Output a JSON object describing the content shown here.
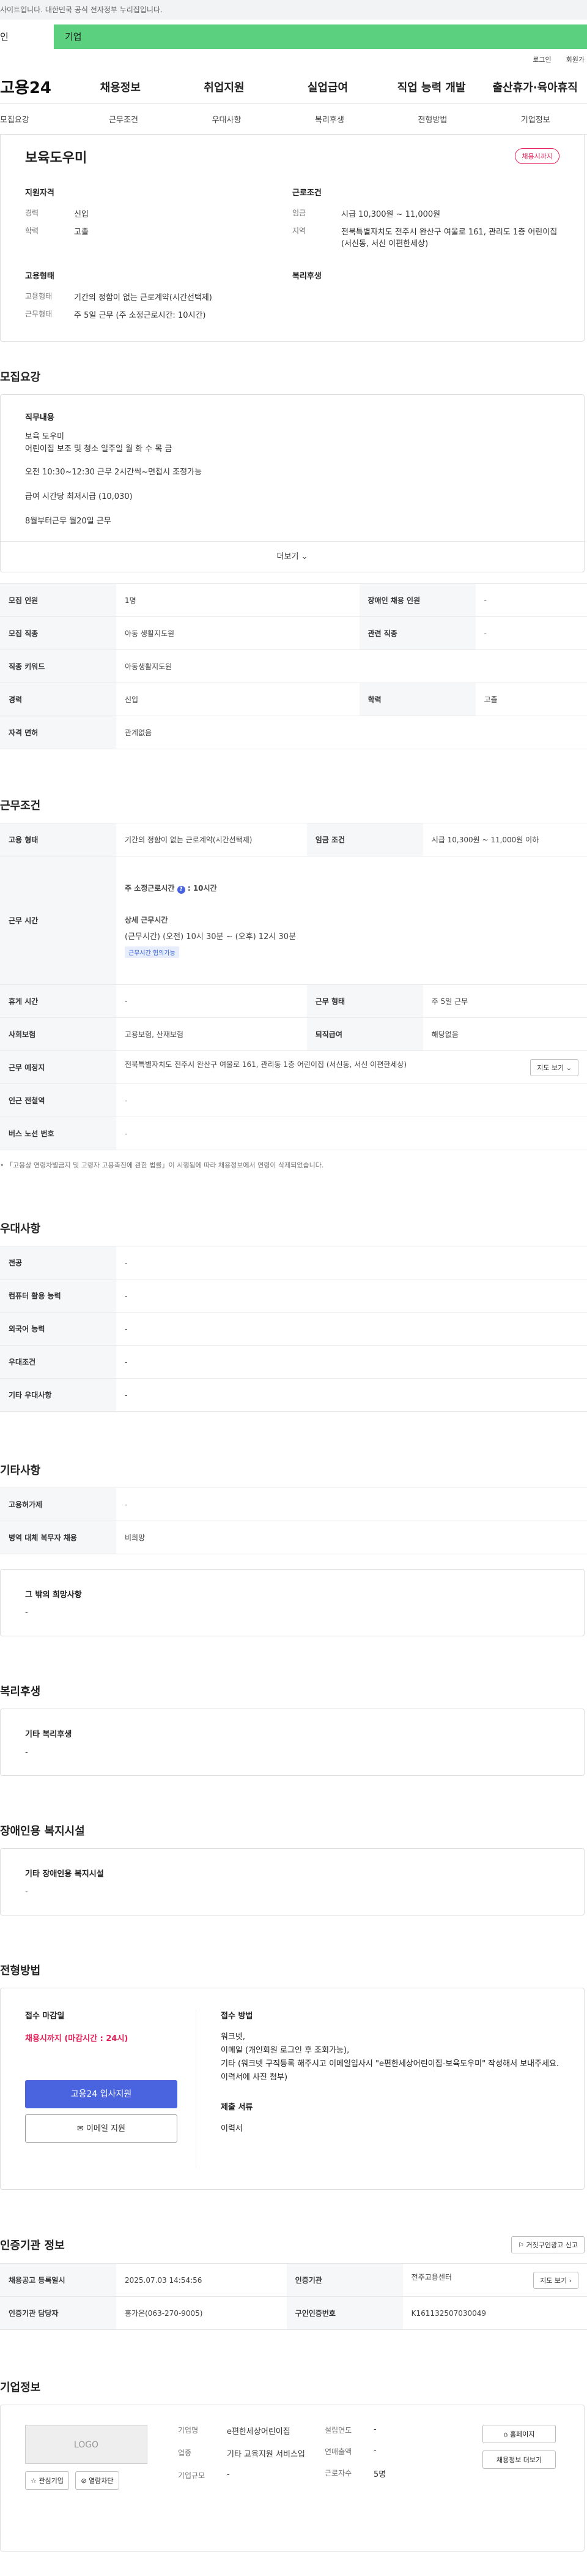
{
  "notice": "사이트입니다. 대한민국 공식 전자정부 누리집입니다.",
  "tabs": {
    "individual": "인",
    "enterprise": "기업"
  },
  "util": {
    "login": "로그인",
    "join": "회원가"
  },
  "logo": "고용24",
  "gnb": [
    "채용정보",
    "취업지원",
    "실업급여",
    "직업 능력 개발",
    "출산휴가·육아휴직"
  ],
  "subnav": [
    "모집요강",
    "근무조건",
    "우대사항",
    "복리후생",
    "전형방법",
    "기업정보"
  ],
  "summary": {
    "title": "보육도우미",
    "badge": "채용시까지",
    "qualification_title": "지원자격",
    "career_label": "경력",
    "career_value": "신입",
    "edu_label": "학력",
    "edu_value": "고졸",
    "emp_title": "고용형태",
    "emptype_label": "고용형태",
    "emptype_value": "기간의 정함이 없는 근로계약(시간선택제)",
    "workform_label": "근무형태",
    "workform_value": "주 5일 근무 (주 소정근로시간: 10시간)",
    "cond_title": "근로조건",
    "wage_label": "임금",
    "wage_value": "시급 10,300원 ~ 11,000원",
    "region_label": "지역",
    "region_value": "전북특별자치도 전주시 완산구 여울로 161, 관리도 1층 어린이집 (서신동, 서신 이편한세상)",
    "welfare_title": "복리후생"
  },
  "recruit": {
    "heading": "모집요강",
    "duty_title": "직무내용",
    "lines": [
      "보육 도우미",
      "어린이집 보조 및 청소 일주일 월 화 수 목 금",
      "오전 10:30~12:30 근무  2시간씩~면접시 조정가능",
      "급여 시간당 최저시급 (10,030)",
      "8월부터근무 월20일 근무"
    ],
    "more": "더보기"
  },
  "recruit_table": [
    [
      "모집 인원",
      "1명",
      "장애인 채용 인원",
      "-"
    ],
    [
      "모집 직종",
      "아동 생활지도원",
      "관련 직종",
      "-"
    ],
    [
      "직종 키워드",
      "아동생활지도원",
      "",
      ""
    ],
    [
      "경력",
      "신입",
      "학력",
      "고졸"
    ],
    [
      "자격 면허",
      "관계없음",
      "",
      ""
    ]
  ],
  "work": {
    "heading": "근무조건",
    "emp_type_h": "고용 형태",
    "emp_type_v": "기간의 정함이 없는 근로계약(시간선택제)",
    "wage_h": "임금 조건",
    "wage_v": "시급 10,300원 ~ 11,000원 이하",
    "time_h": "근무 시간",
    "weekly": "주 소정근로시간",
    "weekly_v": "10시간",
    "detail": "상세 근무시간",
    "detail_v": "(근무시간) (오전) 10시 30분 ~ (오후) 12시 30분",
    "chip": "근무시간 협의가능",
    "rest_h": "휴게 시간",
    "rest_v": "-",
    "form_h": "근무 형태",
    "form_v": "주 5일 근무",
    "ins_h": "사회보험",
    "ins_v": "고용보험, 산재보험",
    "ret_h": "퇴직급여",
    "ret_v": "해당없음",
    "place_h": "근무 예정지",
    "place_v": "전북특별자치도 전주시 완산구 여울로 161, 관리동 1층 어린이집 (서신동, 서신 이편한세상)",
    "map_btn": "지도 보기",
    "subway_h": "인근 전철역",
    "subway_v": "-",
    "bus_h": "버스 노선 번호",
    "bus_v": "-",
    "note": "「고용상 연령차별금지 및 고령자 고용촉진에 관한 법률」이 시행됨에 따라 채용정보에서 연령이 삭제되었습니다."
  },
  "pref": {
    "heading": "우대사항",
    "rows": [
      [
        "전공",
        "-"
      ],
      [
        "컴퓨터 활용 능력",
        "-"
      ],
      [
        "외국어 능력",
        "-"
      ],
      [
        "우대조건",
        "-"
      ],
      [
        "기타 우대사항",
        "-"
      ]
    ]
  },
  "etc": {
    "heading": "기타사항",
    "rows": [
      [
        "고용허가제",
        "-"
      ],
      [
        "병역 대체 복무자 채용",
        "비희망"
      ]
    ],
    "box_title": "그 밖의 희망사항",
    "box_value": "-"
  },
  "welfare": {
    "heading": "복리후생",
    "box_title": "기타 복리후생",
    "box_value": "-"
  },
  "disabled": {
    "heading": "장애인용 복지시설",
    "box_title": "기타 장애인용 복지시설",
    "box_value": "-"
  },
  "selection": {
    "heading": "전형방법",
    "deadline_title": "접수 마감일",
    "deadline_value": "채용시까지 (마감시간 : 24시)",
    "apply_btn": "고용24 입사지원",
    "email_btn": "이메일 지원",
    "method_title": "접수 방법",
    "method_lines": [
      "워크넷,",
      "이메일 (개인회원 로그인 후 조회가능),",
      "기타 (워크넷 구직등록 해주시고 이메일입사시 \"e편한세상어린이집-보육도우미\" 작성해서 보내주세요. 이력서에 사진 첨부)"
    ],
    "docs_title": "제출 서류",
    "docs_value": "이력서"
  },
  "cert": {
    "heading": "인증기관 정보",
    "report_btn": "거짓구인광고 신고",
    "rows": [
      [
        "채용공고 등록일시",
        "2025.07.03 14:54:56",
        "인증기관",
        "전주고용센터"
      ],
      [
        "인증기관 담당자",
        "홍가은(063-270-9005)",
        "구인인증번호",
        "K161132507030049"
      ]
    ],
    "map_btn": "지도 보기"
  },
  "company": {
    "heading": "기업정보",
    "logo_text": "LOGO",
    "fav_btn": "관심기업",
    "block_btn": "열람차단",
    "name_label": "기업명",
    "name_value": "e편한세상어린이집",
    "industry_label": "업종",
    "industry_value": "기타 교육지원 서비스업",
    "size_label": "기업규모",
    "size_value": "-",
    "founded_label": "설립연도",
    "founded_value": "-",
    "sales_label": "연매출액",
    "sales_value": "-",
    "emp_label": "근로자수",
    "emp_value": "5명",
    "home_btn": "홈페이지",
    "jobs_btn": "채용정보 더보기"
  }
}
